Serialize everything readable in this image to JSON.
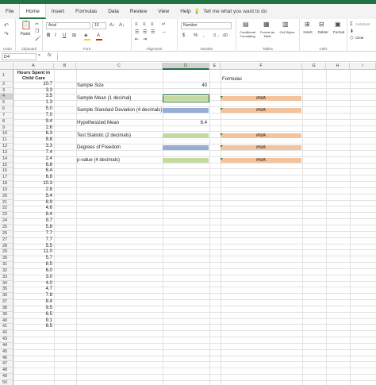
{
  "ribbon_tabs": [
    "File",
    "Home",
    "Insert",
    "Formulas",
    "Data",
    "Review",
    "View",
    "Help"
  ],
  "active_tab": "Home",
  "tell_me": "Tell me what you want to do",
  "ribbon": {
    "undo_label": "Undo",
    "paste_label": "Paste",
    "clipboard_label": "Clipboard",
    "font_name": "Arial",
    "font_size": "10",
    "font_label": "Font",
    "alignment_label": "Alignment",
    "number_format": "Number",
    "number_label": "Number",
    "currency_symbol": "$",
    "percent_symbol": "%",
    "comma_symbol": ",",
    "conditional_formatting": "Conditional Formatting",
    "format_as_table": "Format as Table",
    "cell_styles": "Cell Styles",
    "tables_label": "Tables",
    "insert_label": "Insert",
    "delete_label": "Delete",
    "format_label": "Format",
    "cells_label": "Cells",
    "autosum_label": "AutoSum",
    "clear_label": "Clear"
  },
  "name_box": "D4",
  "fx": "fx",
  "columns": [
    "A",
    "B",
    "C",
    "D",
    "E",
    "F",
    "G",
    "H",
    "I"
  ],
  "selected_column": "D",
  "selected_row": 4,
  "rows": [
    "1",
    "2",
    "3",
    "4",
    "5",
    "6",
    "7",
    "8",
    "9",
    "10",
    "11",
    "12",
    "13",
    "14",
    "15",
    "16",
    "17",
    "18",
    "19",
    "20",
    "21",
    "22",
    "23",
    "24",
    "25",
    "26",
    "27",
    "28",
    "29",
    "30",
    "31",
    "32",
    "33",
    "34",
    "35",
    "36",
    "37",
    "38",
    "39",
    "40",
    "41",
    "42",
    "43",
    "44",
    "45",
    "46",
    "47",
    "48",
    "49",
    "50"
  ],
  "header_a": "Hours Spent in Child Care",
  "hours": [
    "10.7",
    "3.3",
    "3.5",
    "1.3",
    "5.0",
    "7.0",
    "9.4",
    "2.6",
    "6.3",
    "8.8",
    "3.3",
    "7.4",
    "2.4",
    "6.8",
    "6.4",
    "6.8",
    "10.3",
    "2.8",
    "5.4",
    "8.9",
    "4.6",
    "8.4",
    "9.7",
    "5.8",
    "7.7",
    "7.7",
    "5.5",
    "11.0",
    "5.7",
    "8.5",
    "6.0",
    "3.0",
    "4.0",
    "4.7",
    "7.8",
    "8.4",
    "9.5",
    "6.5",
    "9.1",
    "6.5"
  ],
  "labels": {
    "sample_size": "Sample Size",
    "sample_size_value": "40",
    "sample_mean": "Sample Mean (1 decimal)",
    "sample_sd": "Sample Standard Deviation (4 decimals)",
    "hyp_mean": "Hypothesized Mean",
    "hyp_mean_value": "6.4",
    "test_stat": "Test Statistic (2 decimals)",
    "dof": "Degrees of Freedom",
    "pvalue": "p-value (4 decimals)",
    "formulas": "Formulas",
    "na": "#N/A"
  },
  "colors": {
    "excel_green": "#217346",
    "input_green": "#c5d9a0",
    "input_blue": "#96aed6",
    "formula_orange": "#f4c29b"
  }
}
